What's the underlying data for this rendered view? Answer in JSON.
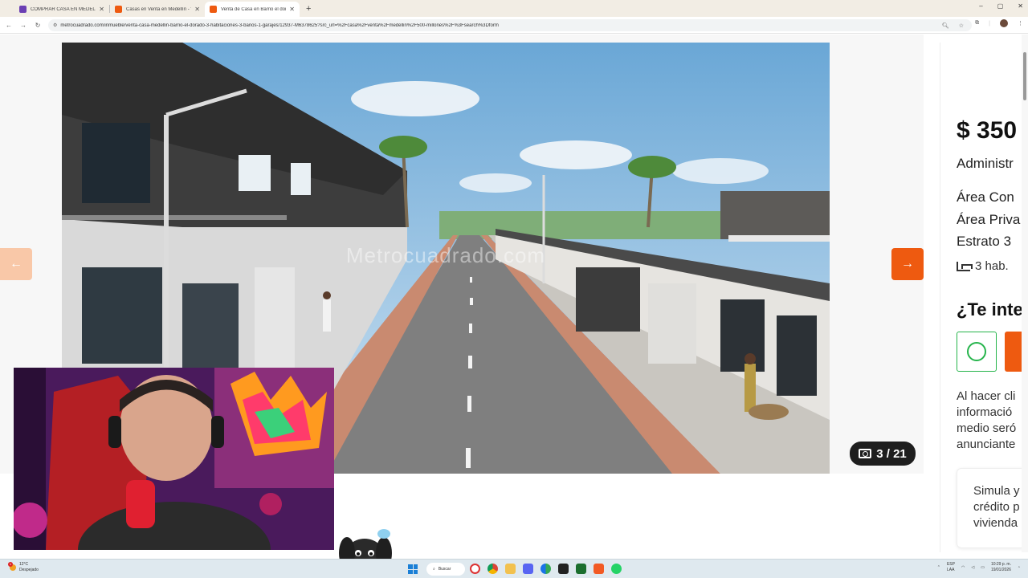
{
  "browser": {
    "tabs": [
      {
        "label": "COMPRAR CASA EN MEDELLIN",
        "active": false,
        "favicon_color": "#6b3fb3"
      },
      {
        "label": "Casas en Venta en Medellín - V",
        "active": false,
        "favicon_color": "#ee5a10"
      },
      {
        "label": "Venta de Casa en Barrio el dora",
        "active": true,
        "favicon_color": "#ee5a10"
      }
    ],
    "new_tab": "+",
    "window_controls": [
      "–",
      "▢",
      "✕"
    ],
    "url": "metrocuadrado.com/inmueble/venta-casa-medellin-barrio-el-dorado-3-habitaciones-3-banos-1-garajes/12937-M6378625?src_url=%2Fcasa%2Fventa%2Fmedellin%2F500-millones%2F%3Fsearch%3Dform"
  },
  "gallery": {
    "watermark": "Metrocuadrado.com",
    "counter": "3 / 21",
    "prev_icon": "←",
    "next_icon": "→"
  },
  "listing": {
    "price": "$ 350",
    "admin": "Administr",
    "area_construida": "Área Con",
    "area_privada": "Área Priva",
    "estrato": "Estrato 3",
    "rooms": "3 hab.",
    "interest_heading": "¿Te inte",
    "legal_lines": [
      "Al hacer cli",
      "informació",
      "medio seró",
      "anunciante"
    ],
    "simula_lines": [
      "Simula y",
      "crédito p",
      "vivienda"
    ]
  },
  "taskbar": {
    "weather_temp": "12°C",
    "weather_desc": "Despejado",
    "notification_count": "1",
    "search_label": "Buscar",
    "lang_top": "ESP",
    "lang_bottom": "LAA",
    "time": "10:29 p. m.",
    "date": "19/01/2026"
  },
  "colors": {
    "brand_orange": "#ee5a10",
    "whatsapp_green": "#25b44b"
  }
}
